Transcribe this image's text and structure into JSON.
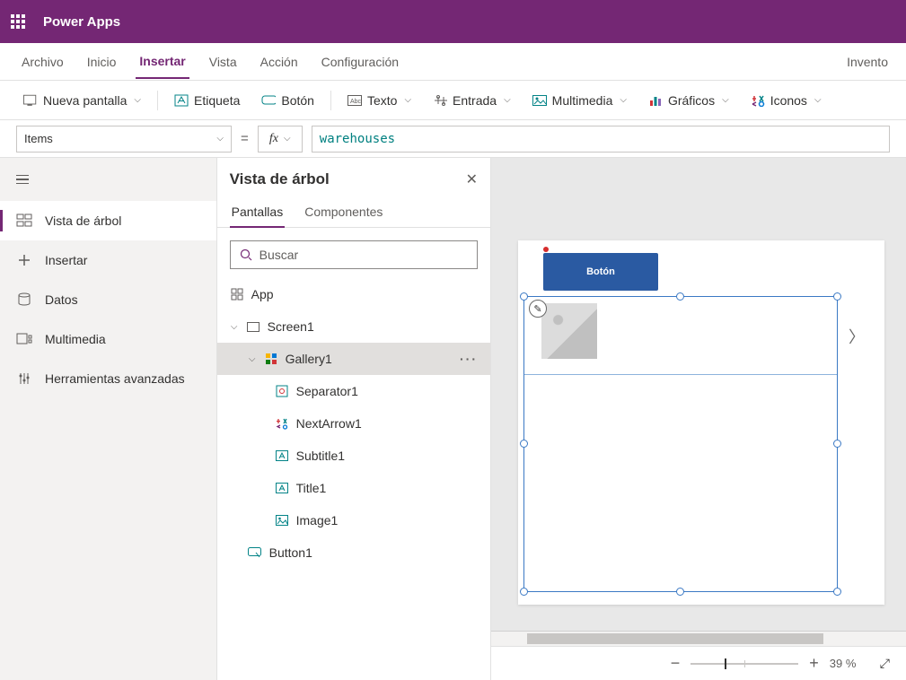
{
  "header": {
    "app_title": "Power Apps"
  },
  "menubar": {
    "archivo": "Archivo",
    "inicio": "Inicio",
    "insertar": "Insertar",
    "vista": "Vista",
    "accion": "Acción",
    "config": "Configuración",
    "right": "Invento"
  },
  "toolbar": {
    "new_screen": "Nueva pantalla",
    "etiqueta": "Etiqueta",
    "boton": "Botón",
    "texto": "Texto",
    "entrada": "Entrada",
    "multimedia": "Multimedia",
    "graficos": "Gráficos",
    "iconos": "Iconos"
  },
  "formula": {
    "property": "Items",
    "value": "warehouses"
  },
  "leftrail": {
    "tree": "Vista de árbol",
    "insert": "Insertar",
    "data": "Datos",
    "media": "Multimedia",
    "advanced": "Herramientas avanzadas"
  },
  "treepanel": {
    "title": "Vista de árbol",
    "tab_screens": "Pantallas",
    "tab_components": "Componentes",
    "search_placeholder": "Buscar",
    "app": "App",
    "screen": "Screen1",
    "gallery": "Gallery1",
    "separator": "Separator1",
    "nextarrow": "NextArrow1",
    "subtitle": "Subtitle1",
    "title_item": "Title1",
    "image": "Image1",
    "button": "Button1"
  },
  "canvas": {
    "button_label": "Botón"
  },
  "zoom": {
    "pct": "39  %"
  }
}
